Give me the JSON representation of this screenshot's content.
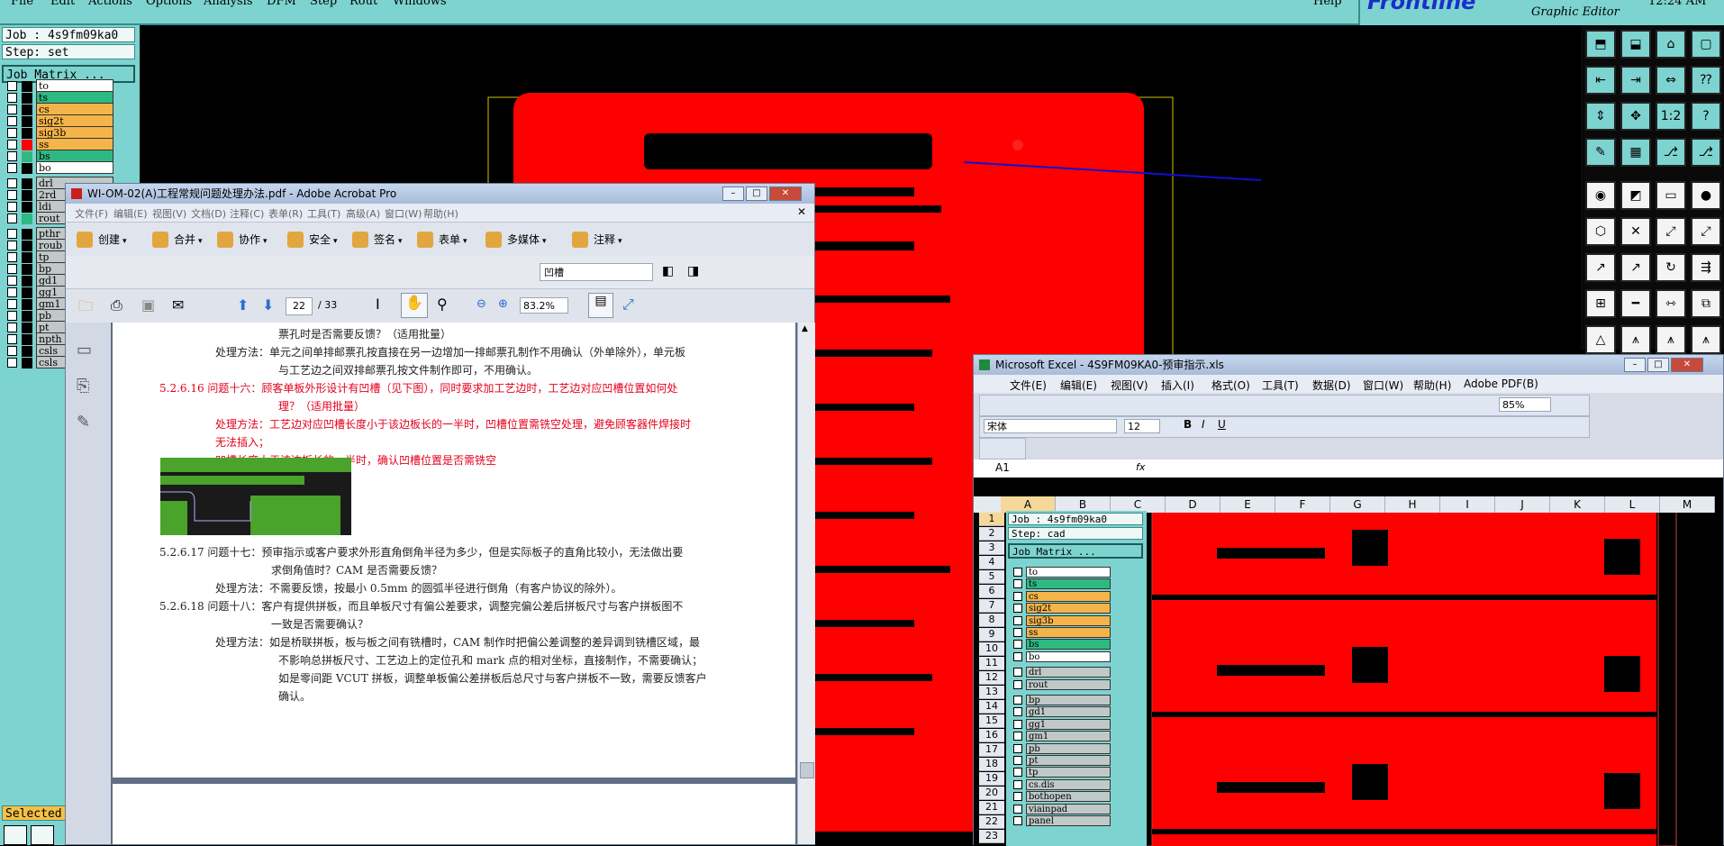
{
  "genesis": {
    "menu": [
      "File",
      "Edit",
      "Actions",
      "Options",
      "Analysis",
      "DFM",
      "Step",
      "Rout",
      "Windows"
    ],
    "help": "Help",
    "brand": "Frontline",
    "brand_sub": "Graphic Editor",
    "clock": "12:24 AM",
    "job": "Job : 4s9fm09ka0",
    "step": "Step: set",
    "job_matrix": "Job Matrix ...",
    "selected": "Selected",
    "layers": [
      {
        "name": "to",
        "color": "#ffffff"
      },
      {
        "name": "ts",
        "color": "#2fb982"
      },
      {
        "name": "cs",
        "color": "#f5b44a"
      },
      {
        "name": "sig2t",
        "color": "#f5b44a"
      },
      {
        "name": "sig3b",
        "color": "#f5b44a"
      },
      {
        "name": "ss",
        "color": "#f5b44a"
      },
      {
        "name": "bs",
        "color": "#2fb982"
      },
      {
        "name": "bo",
        "color": "#ffffff"
      },
      {
        "name": "drl",
        "color": "#c0c8c8"
      },
      {
        "name": "2rd",
        "color": "#c0c8c8"
      },
      {
        "name": "ldi",
        "color": "#c0c8c8"
      },
      {
        "name": "rout",
        "color": "#c0c8c8"
      },
      {
        "name": "pthr",
        "color": "#c0c8c8"
      },
      {
        "name": "roub",
        "color": "#c0c8c8"
      },
      {
        "name": "tp",
        "color": "#c0c8c8"
      },
      {
        "name": "bp",
        "color": "#c0c8c8"
      },
      {
        "name": "gd1",
        "color": "#c0c8c8"
      },
      {
        "name": "gg1",
        "color": "#c0c8c8"
      },
      {
        "name": "gm1",
        "color": "#c0c8c8"
      },
      {
        "name": "pb",
        "color": "#c0c8c8"
      },
      {
        "name": "pt",
        "color": "#c0c8c8"
      },
      {
        "name": "npth",
        "color": "#c0c8c8"
      },
      {
        "name": "csls",
        "color": "#c0c8c8"
      },
      {
        "name": "csls",
        "color": "#c0c8c8"
      }
    ]
  },
  "acrobat": {
    "title": "WI-OM-02(A)工程常规问题处理办法.pdf - Adobe Acrobat Pro",
    "menu": [
      "文件(F)",
      "编辑(E)",
      "视图(V)",
      "文档(D)",
      "注释(C)",
      "表单(R)",
      "工具(T)",
      "高级(A)",
      "窗口(W)",
      "帮助(H)"
    ],
    "toolbar": [
      "创建",
      "合并",
      "协作",
      "安全",
      "签名",
      "表单",
      "多媒体",
      "注释"
    ],
    "search_value": "凹槽",
    "page_current": "22",
    "page_total": "/ 33",
    "zoom": "83.2%",
    "lines": [
      {
        "text": "票孔时是否需要反馈？（适用批量）",
        "cls": ""
      },
      {
        "text": "处理方法：单元之间单排邮票孔按直接在另一边增加一排邮票孔制作不用确认（外单除外），单元板",
        "cls": ""
      },
      {
        "text": "与工艺边之间双排邮票孔按文件制作即可，不用确认。",
        "cls": ""
      },
      {
        "text": "5.2.6.16 问题十六：顾客单板外形设计有凹槽（见下图），同时要求加工艺边时，工艺边对应凹槽位置如何处",
        "cls": "red"
      },
      {
        "text": "理？（适用批量）",
        "cls": "red"
      },
      {
        "text": "处理方法：工艺边对应凹槽长度小于该边板长的一半时，凹槽位置需铣空处理，避免顾客器件焊接时",
        "cls": "red"
      },
      {
        "text": "无法插入；",
        "cls": "red"
      },
      {
        "text": "凹槽长度大于该边板长的一半时，确认凹槽位置是否需铣空",
        "cls": "red"
      },
      {
        "text": "5.2.6.17 问题十七：预审指示或客户要求外形直角倒角半径为多少，但是实际板子的直角比较小，无法做出要",
        "cls": ""
      },
      {
        "text": "求倒角值时？CAM 是否需要反馈？",
        "cls": ""
      },
      {
        "text": "处理方法：不需要反馈，按最小 0.5mm 的圆弧半径进行倒角（有客户协议的除外）。",
        "cls": ""
      },
      {
        "text": "5.2.6.18 问题十八：客户有提供拼板，而且单板尺寸有偏公差要求，调整完偏公差后拼板尺寸与客户拼板图不",
        "cls": ""
      },
      {
        "text": "一致是否需要确认？",
        "cls": ""
      },
      {
        "text": "处理方法：如是桥联拼板，板与板之间有铣槽时，CAM 制作时把偏公差调整的差异调到铣槽区域，最",
        "cls": ""
      },
      {
        "text": "不影响总拼板尺寸、工艺边上的定位孔和 mark 点的相对坐标，直接制作，不需要确认；",
        "cls": ""
      },
      {
        "text": "如是零间距 VCUT 拼板，调整单板偏公差拼板后总尺寸与客户拼板不一致，需要反馈客户",
        "cls": ""
      },
      {
        "text": "确认。",
        "cls": ""
      }
    ]
  },
  "excel": {
    "title": "Microsoft Excel - 4S9FM09KA0-预审指示.xls",
    "menu": [
      "文件(E)",
      "编辑(E)",
      "视图(V)",
      "插入(I)",
      "格式(O)",
      "工具(T)",
      "数据(D)",
      "窗口(W)",
      "帮助(H)",
      "Adobe PDF(B)"
    ],
    "zoom": "85%",
    "font": "宋体",
    "font_size": "12",
    "cell_ref": "A1",
    "fx": "fx",
    "columns": [
      "A",
      "B",
      "C",
      "D",
      "E",
      "F",
      "G",
      "H",
      "I",
      "J",
      "K",
      "L",
      "M"
    ],
    "rows": [
      "1",
      "2",
      "3",
      "4",
      "5",
      "6",
      "7",
      "8",
      "9",
      "10",
      "11",
      "12",
      "13",
      "14",
      "15",
      "16",
      "17",
      "18",
      "19",
      "20",
      "21",
      "22",
      "23"
    ],
    "job": "Job : 4s9fm09ka0",
    "step": "Step: cad",
    "job_matrix": "Job Matrix ...",
    "layers": [
      {
        "name": "to",
        "color": "#ffffff"
      },
      {
        "name": "ts",
        "color": "#2fb982"
      },
      {
        "name": "cs",
        "color": "#f5b44a"
      },
      {
        "name": "sig2t",
        "color": "#f5b44a"
      },
      {
        "name": "sig3b",
        "color": "#f5b44a"
      },
      {
        "name": "ss",
        "color": "#f5b44a"
      },
      {
        "name": "bs",
        "color": "#2fb982"
      },
      {
        "name": "bo",
        "color": "#ffffff"
      },
      {
        "name": "drl",
        "color": "#c0c8c8"
      },
      {
        "name": "rout",
        "color": "#c0c8c8"
      },
      {
        "name": "bp",
        "color": "#c0c8c8"
      },
      {
        "name": "gd1",
        "color": "#c0c8c8"
      },
      {
        "name": "gg1",
        "color": "#c0c8c8"
      },
      {
        "name": "gm1",
        "color": "#c0c8c8"
      },
      {
        "name": "pb",
        "color": "#c0c8c8"
      },
      {
        "name": "pt",
        "color": "#c0c8c8"
      },
      {
        "name": "tp",
        "color": "#c0c8c8"
      },
      {
        "name": "cs.dis",
        "color": "#c0c8c8"
      },
      {
        "name": "bothopen",
        "color": "#c0c8c8"
      },
      {
        "name": "viainpad",
        "color": "#c0c8c8"
      },
      {
        "name": "panel",
        "color": "#c0c8c8"
      }
    ]
  },
  "colors": {
    "board": "#ff0000",
    "genesis_bg": "#7dd3cf",
    "arrow": "#1010d0"
  }
}
